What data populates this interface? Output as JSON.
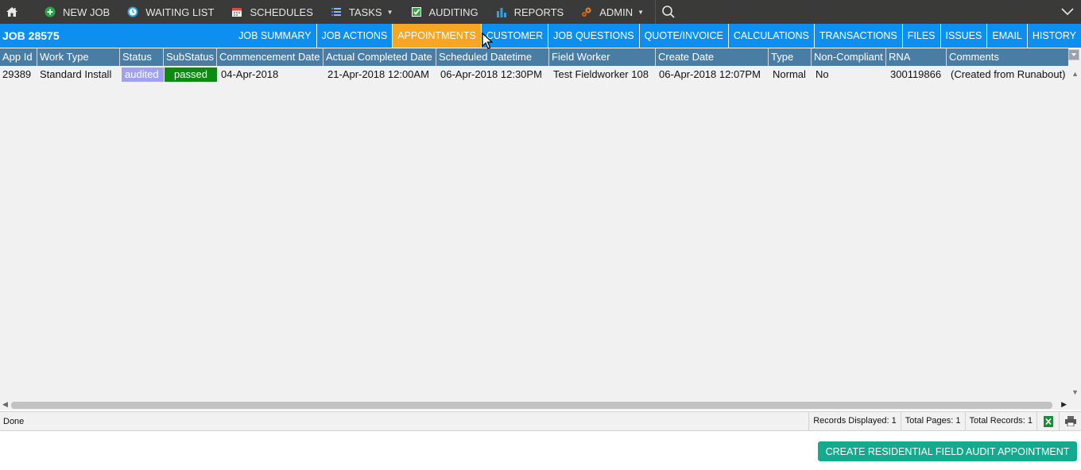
{
  "topnav": {
    "items": [
      {
        "label": "NEW JOB",
        "icon": "plus-circle-icon",
        "icon_color": "#2aa44a"
      },
      {
        "label": "WAITING LIST",
        "icon": "clock-icon",
        "icon_color": "#2aa3d8"
      },
      {
        "label": "SCHEDULES",
        "icon": "calendar-icon",
        "icon_color": "#d94b3d"
      },
      {
        "label": "TASKS",
        "icon": "list-icon",
        "icon_color": "#3b7fd6"
      },
      {
        "label": "AUDITING",
        "icon": "checkbox-icon",
        "icon_color": "#3aa64a"
      },
      {
        "label": "REPORTS",
        "icon": "bar-chart-icon",
        "icon_color": "#29a4e0"
      },
      {
        "label": "ADMIN",
        "icon": "gears-icon",
        "icon_color": "#e07a1f"
      }
    ]
  },
  "job": {
    "title": "JOB 28575",
    "tabs": [
      {
        "label": "JOB SUMMARY"
      },
      {
        "label": "JOB ACTIONS"
      },
      {
        "label": "APPOINTMENTS"
      },
      {
        "label": "CUSTOMER"
      },
      {
        "label": "JOB QUESTIONS"
      },
      {
        "label": "QUOTE/INVOICE"
      },
      {
        "label": "CALCULATIONS"
      },
      {
        "label": "TRANSACTIONS"
      },
      {
        "label": "FILES"
      },
      {
        "label": "ISSUES"
      },
      {
        "label": "EMAIL"
      },
      {
        "label": "HISTORY"
      }
    ],
    "active_tab": "APPOINTMENTS"
  },
  "grid": {
    "columns": [
      "App Id",
      "Work Type",
      "Status",
      "SubStatus",
      "Commencement Date",
      "Actual Completed Date",
      "Scheduled Datetime",
      "Field Worker",
      "Create Date",
      "Type",
      "Non-Compliant",
      "RNA",
      "Comments"
    ],
    "rows": [
      {
        "app_id": "29389",
        "work_type": "Standard Install",
        "status": "audited",
        "substatus": "passed",
        "commencement_date": "04-Apr-2018",
        "actual_completed_date": "21-Apr-2018 12:00AM",
        "scheduled_datetime": "06-Apr-2018 12:30PM",
        "field_worker": "Test Fieldworker 108",
        "create_date": "06-Apr-2018 12:07PM",
        "type": "Normal",
        "non_compliant": "No",
        "rna": "300119866",
        "comments": "(Created from Runabout)"
      }
    ]
  },
  "statusbar": {
    "status": "Done",
    "records_displayed": "Records Displayed: 1",
    "total_pages": "Total Pages: 1",
    "total_records": "Total Records: 1"
  },
  "actions": {
    "create_label": "CREATE RESIDENTIAL FIELD AUDIT APPOINTMENT"
  },
  "colors": {
    "nav_bg": "#3a3a3a",
    "job_bar": "#0d8ff2",
    "active_tab": "#f6a623",
    "grid_header": "#4a7da3",
    "audited": "#9fa3ef",
    "passed": "#0c8a12",
    "create_button": "#13aa8e"
  }
}
